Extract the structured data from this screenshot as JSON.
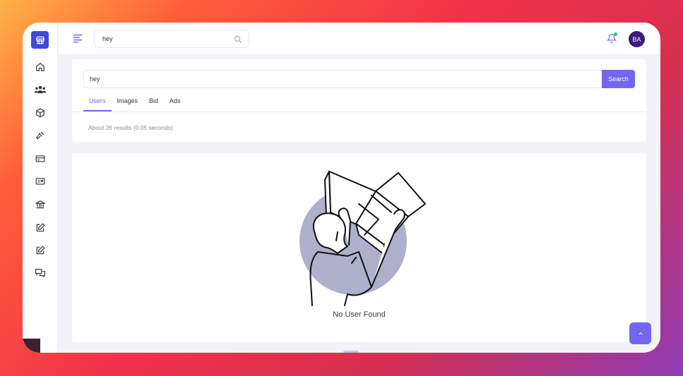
{
  "topbar": {
    "search_value": "hey",
    "avatar_initials": "BA",
    "notification_dot_color": "#2ec46b"
  },
  "sidebar": {
    "items": [
      {
        "icon": "store-icon"
      },
      {
        "icon": "home-icon"
      },
      {
        "icon": "users-icon"
      },
      {
        "icon": "box-icon"
      },
      {
        "icon": "gavel-icon"
      },
      {
        "icon": "credit-card-icon"
      },
      {
        "icon": "id-card-icon"
      },
      {
        "icon": "bank-icon"
      },
      {
        "icon": "edit-icon"
      },
      {
        "icon": "edit-icon"
      },
      {
        "icon": "chat-icon"
      }
    ]
  },
  "search": {
    "value": "hey",
    "button_label": "Search",
    "tabs": [
      "Users",
      "Images",
      "Bid",
      "Ads"
    ],
    "active_tab": "Users",
    "results_summary": "About 26 results (0.05 seconds)"
  },
  "results": {
    "empty_message": "No User Found"
  },
  "colors": {
    "accent": "#7367f0",
    "brand": "#3f4ad8",
    "avatar_bg": "#3a1a7a"
  }
}
